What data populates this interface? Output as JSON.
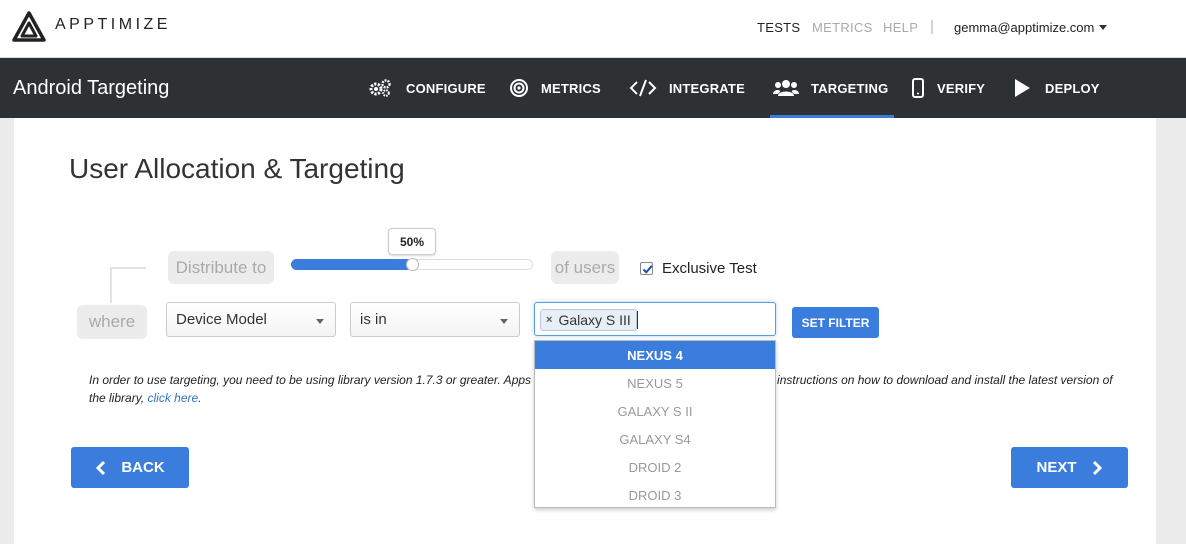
{
  "brand": {
    "name": "APPTIMIZE"
  },
  "top_nav": {
    "tests": "TESTS",
    "metrics": "METRICS",
    "help": "HELP",
    "separator": "|",
    "user": "gemma@apptimize.com"
  },
  "navbar": {
    "app_title": "Android Targeting",
    "tabs": [
      {
        "label": "CONFIGURE",
        "icon": "gears-icon"
      },
      {
        "label": "METRICS",
        "icon": "target-icon"
      },
      {
        "label": "INTEGRATE",
        "icon": "code-icon"
      },
      {
        "label": "TARGETING",
        "icon": "users-icon",
        "active": true
      },
      {
        "label": "VERIFY",
        "icon": "phone-icon"
      },
      {
        "label": "DEPLOY",
        "icon": "play-icon"
      }
    ]
  },
  "main": {
    "heading": "User Allocation & Targeting",
    "distribute_label": "Distribute to",
    "slider_value": "50%",
    "slider_fraction": 0.5,
    "of_users_label": "of users",
    "exclusive_test_label": "Exclusive Test",
    "exclusive_test_checked": true,
    "where_label": "where",
    "attribute_select": "Device Model",
    "operator_select": "is in",
    "selected_tags": [
      "Galaxy S III"
    ],
    "set_filter_label": "SET FILTER",
    "dropdown_options": [
      "NEXUS 4",
      "NEXUS 5",
      "GALAXY S II",
      "GALAXY S4",
      "DROID 2",
      "DROID 3"
    ],
    "highlighted_option": "NEXUS 4",
    "note_part1": "In order to use targeting, you need to be using library version 1.7.3 or greater. Apps",
    "note_part2": "instructions on how to download and install the latest version",
    "note_part3": "of the library,",
    "note_link": "click here",
    "note_end": ".",
    "back_label": "BACK",
    "next_label": "NEXT"
  },
  "colors": {
    "accent": "#3b7ddd",
    "navbar_bg": "#2e3134"
  }
}
